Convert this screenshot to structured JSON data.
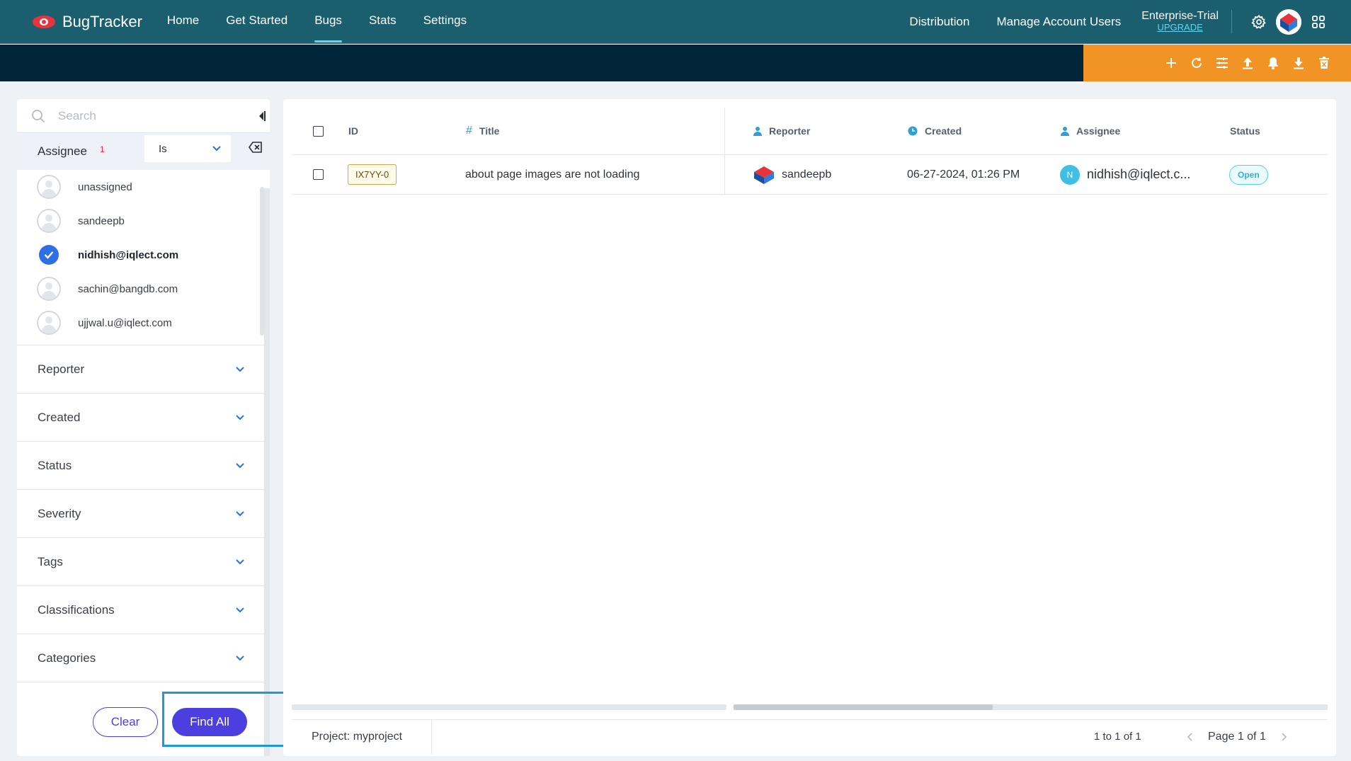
{
  "app": {
    "name": "BugTracker"
  },
  "nav": {
    "links": [
      {
        "label": "Home"
      },
      {
        "label": "Get Started"
      },
      {
        "label": "Bugs",
        "active": true
      },
      {
        "label": "Stats"
      },
      {
        "label": "Settings"
      }
    ],
    "right_links": [
      {
        "label": "Distribution"
      },
      {
        "label": "Manage Account Users"
      }
    ],
    "plan": {
      "name": "Enterprise-Trial",
      "upgrade": "UPGRADE"
    }
  },
  "toolbar": {
    "icons": [
      "plus-icon",
      "refresh-icon",
      "sliders-icon",
      "upload-icon",
      "bell-icon",
      "download-icon",
      "trash-icon"
    ]
  },
  "filters": {
    "search_placeholder": "Search",
    "assignee": {
      "label": "Assignee",
      "count": "1",
      "operator": "Is",
      "options": [
        {
          "name": "unassigned",
          "selected": false
        },
        {
          "name": "sandeepb",
          "selected": false
        },
        {
          "name": "nidhish@iqlect.com",
          "selected": true
        },
        {
          "name": "sachin@bangdb.com",
          "selected": false
        },
        {
          "name": "ujjwal.u@iqlect.com",
          "selected": false
        }
      ]
    },
    "sections": [
      "Reporter",
      "Created",
      "Status",
      "Severity",
      "Tags",
      "Classifications",
      "Categories"
    ],
    "clear_label": "Clear",
    "find_label": "Find All"
  },
  "table": {
    "headers": {
      "id": "ID",
      "title": "Title",
      "reporter": "Reporter",
      "created": "Created",
      "assignee": "Assignee",
      "status": "Status"
    },
    "rows": [
      {
        "id": "IX7YY-0",
        "title": "about page images are not loading",
        "reporter": "sandeepb",
        "created": "06-27-2024, 01:26 PM",
        "assignee_initial": "N",
        "assignee": "nidhish@iqlect.c...",
        "status": "Open"
      }
    ],
    "footer": {
      "project": "Project: myproject",
      "range": "1 to 1 of 1",
      "page": "Page 1 of 1"
    }
  },
  "colors": {
    "nav_bg": "#1b5e6e",
    "band_bg": "#01263a",
    "band_orange": "#f29325",
    "primary": "#4b3fe0",
    "highlight": "#1d9ad6"
  }
}
